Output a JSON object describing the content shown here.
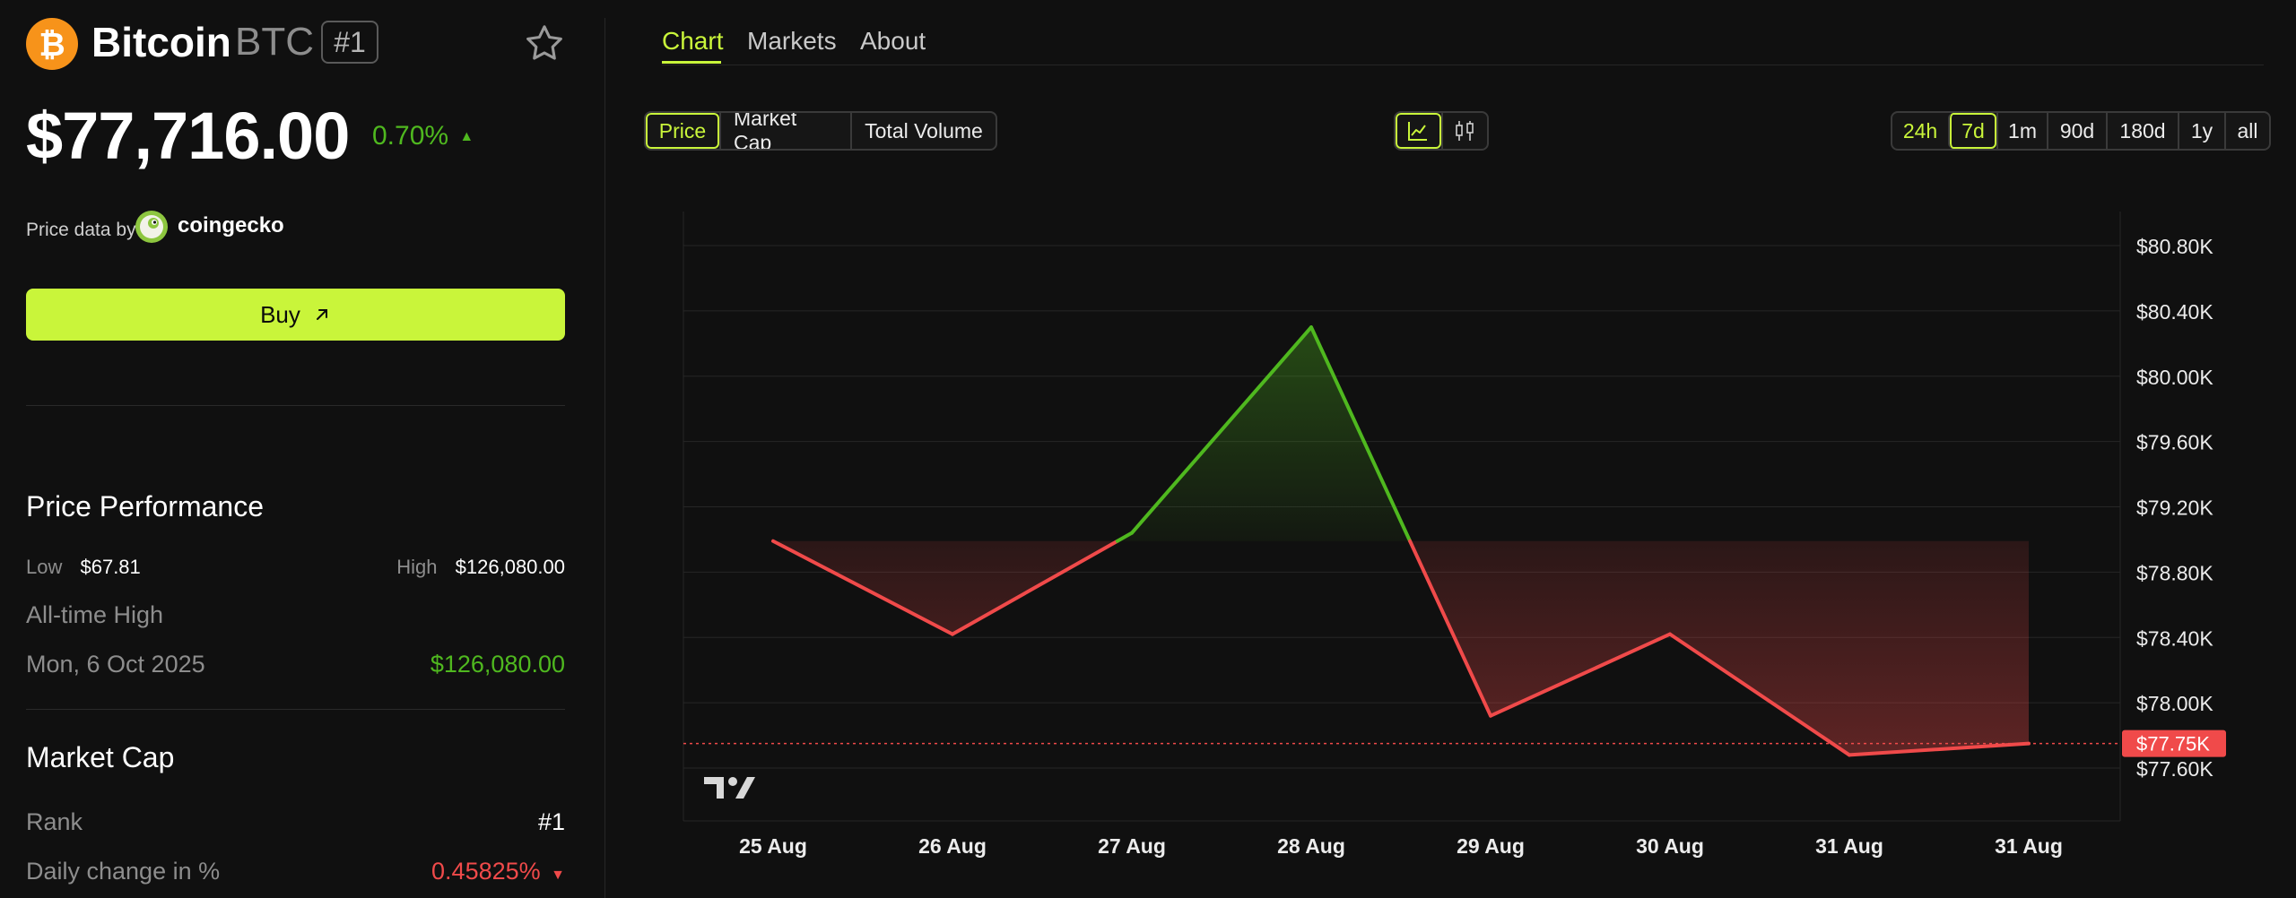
{
  "coin": {
    "name": "Bitcoin",
    "ticker": "BTC",
    "rank_badge": "#1",
    "price": "$77,716.00",
    "change": "0.70%",
    "change_direction": "up",
    "price_data_by": "Price data by",
    "provider": "coingecko",
    "buy_label": "Buy"
  },
  "performance": {
    "title": "Price Performance",
    "low_label": "Low",
    "low_value": "$67.81",
    "high_label": "High",
    "high_value": "$126,080.00",
    "ath_label": "All-time High",
    "ath_date": "Mon, 6 Oct 2025",
    "ath_value": "$126,080.00"
  },
  "market_cap": {
    "title": "Market Cap",
    "rank_label": "Rank",
    "rank_value": "#1",
    "daily_change_label": "Daily change in %",
    "daily_change_value": "0.45825%"
  },
  "tabs": [
    {
      "label": "Chart",
      "active": true
    },
    {
      "label": "Markets",
      "active": false
    },
    {
      "label": "About",
      "active": false
    }
  ],
  "metric_buttons": [
    {
      "label": "Price",
      "active": true
    },
    {
      "label": "Market Cap",
      "active": false
    },
    {
      "label": "Total Volume",
      "active": false
    }
  ],
  "chart_type_buttons": [
    {
      "icon": "line-chart-icon",
      "active": true
    },
    {
      "icon": "candlestick-icon",
      "active": false
    }
  ],
  "range_buttons": [
    {
      "label": "24h",
      "active": false
    },
    {
      "label": "7d",
      "active": true
    },
    {
      "label": "1m",
      "active": false
    },
    {
      "label": "90d",
      "active": false
    },
    {
      "label": "180d",
      "active": false
    },
    {
      "label": "1y",
      "active": false
    },
    {
      "label": "all",
      "active": false
    }
  ],
  "colors": {
    "accent": "#c9f53a",
    "up": "#4fb81f",
    "down": "#f04a4a",
    "bitcoin": "#f7931a"
  },
  "chart_data": {
    "type": "line",
    "x": [
      "25 Aug",
      "26 Aug",
      "27 Aug",
      "28 Aug",
      "29 Aug",
      "30 Aug",
      "31 Aug",
      "31 Aug"
    ],
    "values": [
      78990,
      78420,
      79040,
      80300,
      77920,
      78420,
      77680,
      77750
    ],
    "baseline": 78990,
    "current_label": "$77.75K",
    "current_value": 77750,
    "y_ticks": [
      "$80.80K",
      "$80.40K",
      "$80.00K",
      "$79.60K",
      "$79.20K",
      "$78.80K",
      "$78.40K",
      "$78.00K",
      "$77.60K"
    ],
    "y_tick_values": [
      80800,
      80400,
      80000,
      79600,
      79200,
      78800,
      78400,
      78000,
      77600
    ],
    "ylim": [
      77600,
      80800
    ],
    "grid": true,
    "watermark": "TV"
  }
}
